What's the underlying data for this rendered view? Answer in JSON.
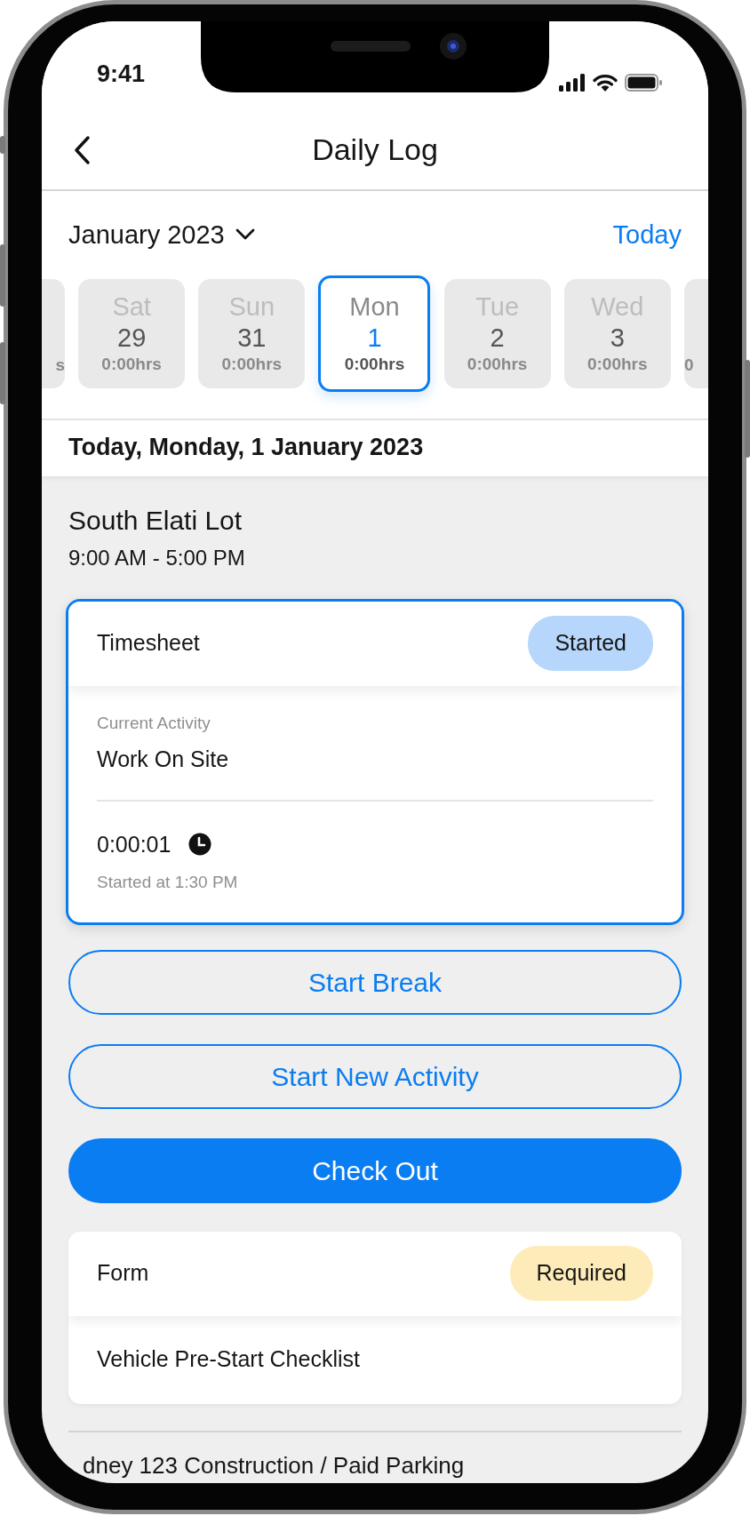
{
  "status_bar": {
    "time": "9:41"
  },
  "header": {
    "title": "Daily Log"
  },
  "month": {
    "label": "January 2023",
    "today_link": "Today"
  },
  "days": [
    {
      "kind": "partial_left",
      "hours": "s",
      "selected": false
    },
    {
      "kind": "day",
      "weekday": "Sat",
      "date": "29",
      "hours": "0:00hrs",
      "selected": false
    },
    {
      "kind": "day",
      "weekday": "Sun",
      "date": "31",
      "hours": "0:00hrs",
      "selected": false
    },
    {
      "kind": "day",
      "weekday": "Mon",
      "date": "1",
      "hours": "0:00hrs",
      "selected": true
    },
    {
      "kind": "day",
      "weekday": "Tue",
      "date": "2",
      "hours": "0:00hrs",
      "selected": false
    },
    {
      "kind": "day",
      "weekday": "Wed",
      "date": "3",
      "hours": "0:00hrs",
      "selected": false
    },
    {
      "kind": "partial_right",
      "hours": "0",
      "selected": false
    }
  ],
  "date_heading": "Today, Monday, 1 January 2023",
  "site": {
    "name": "South Elati Lot",
    "hours": "9:00 AM - 5:00 PM"
  },
  "timesheet": {
    "title": "Timesheet",
    "status": "Started",
    "kind": "started",
    "activity_label": "Current Activity",
    "activity": "Work On Site",
    "elapsed": "0:00:01",
    "started_at": "Started at 1:30 PM"
  },
  "actions": [
    {
      "label": "Start Break",
      "kind": "outline"
    },
    {
      "label": "Start New Activity",
      "kind": "outline"
    },
    {
      "label": "Check Out",
      "kind": "primary"
    }
  ],
  "form": {
    "title": "Form",
    "status": "Required",
    "kind": "required",
    "item": "Vehicle Pre-Start Checklist"
  },
  "next_site": {
    "name": "dney 123 Construction / Paid Parking"
  }
}
